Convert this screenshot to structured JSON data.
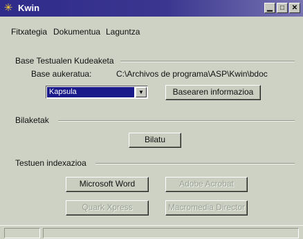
{
  "window": {
    "title": "Kwin"
  },
  "menu": [
    "Fitxategia",
    "Dokumentua",
    "Laguntza"
  ],
  "sections": {
    "base": "Base Testualen Kudeaketa",
    "search": "Bilaketak",
    "indexing": "Testuen indexazioa"
  },
  "base": {
    "selected_label": "Base aukeratua:",
    "path": "C:\\Archivos de programa\\ASP\\Kwin\\bdoc",
    "combo_value": "Kapsula",
    "info_button": "Basearen informazioa"
  },
  "search": {
    "button": "Bilatu"
  },
  "indexing": {
    "word": "Microsoft Word",
    "acrobat": "Adobe Acrobat",
    "quark": "Quark Xpress",
    "director": "Macromedia Director"
  },
  "icons": {
    "app": "kwin-app-icon",
    "minimize": "minimize-icon",
    "maximize": "maximize-icon",
    "close": "close-icon",
    "dropdown": "chevron-down-icon"
  }
}
